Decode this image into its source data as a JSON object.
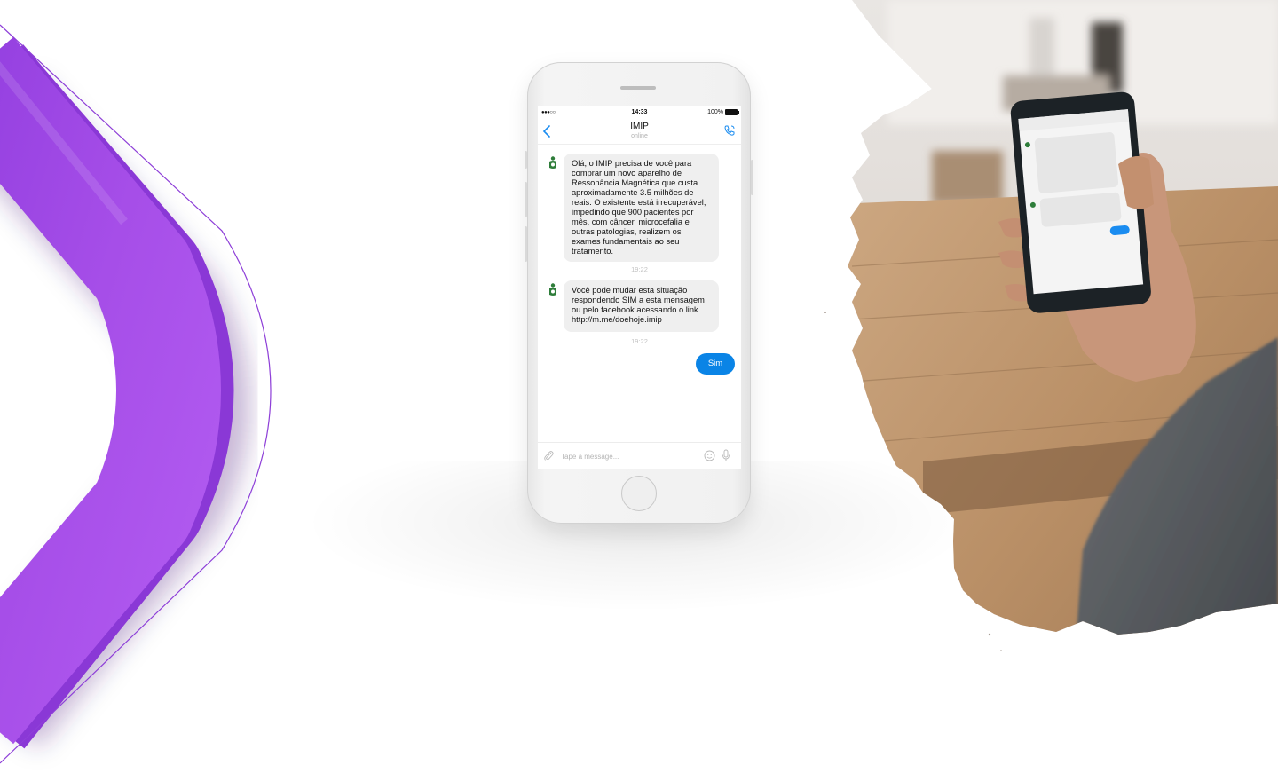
{
  "chat": {
    "status_bar": {
      "signal": "●●●○○",
      "time": "14:33",
      "battery": "100%"
    },
    "header": {
      "title": "IMIP",
      "status": "online"
    },
    "messages": [
      {
        "direction": "incoming",
        "text": "Olá, o IMIP precisa de você para comprar um novo aparelho de Ressonância Magnética que custa aproximadamente 3.5 milhões de reais. O existente está irrecuperável, impedindo que 900 pacientes por mês, com câncer, microcefalia e outras patologias, realizem os exames fundamentais ao seu tratamento.",
        "time": "19:22"
      },
      {
        "direction": "incoming",
        "text": "Você pode mudar esta situação respondendo SIM a esta mensagem ou pelo facebook acessando o link http://m.me/doehoje.imip",
        "time": "19:22"
      },
      {
        "direction": "outgoing",
        "text": "Sim"
      }
    ],
    "composer": {
      "placeholder": "Tape a message..."
    }
  },
  "colors": {
    "accent_purple": "#a24ce6",
    "bubble_outgoing": "#0a84e6",
    "bubble_incoming": "#efefef",
    "avatar_green": "#2e7d3a"
  },
  "icons": [
    "back-arrow-icon",
    "phone-call-icon",
    "paperclip-icon",
    "emoji-icon",
    "microphone-icon",
    "avatar-icon"
  ]
}
